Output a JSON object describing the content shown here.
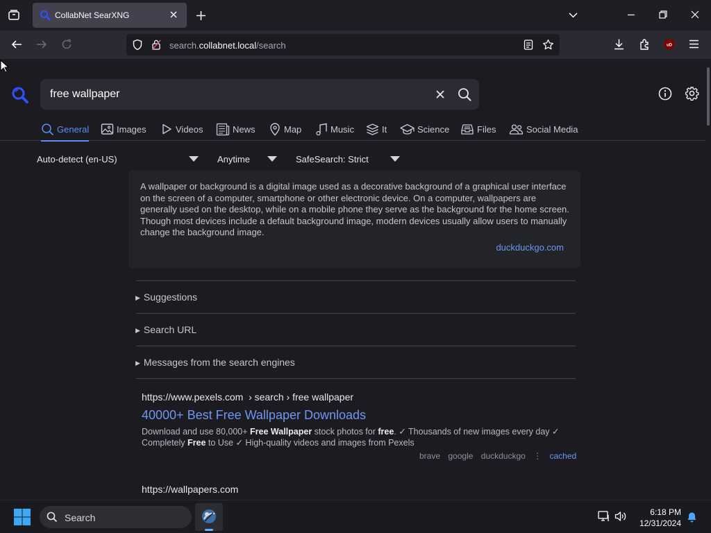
{
  "browser": {
    "tab_title": "CollabNet SearXNG",
    "url_host": "search.collabnet.local",
    "url_path": "/search",
    "url_prefix": "search.",
    "url_domain": "collabnet.local",
    "addon_badge": "uD"
  },
  "search": {
    "query": "free wallpaper"
  },
  "categories": [
    {
      "label": "General",
      "icon": "search-icon",
      "active": true
    },
    {
      "label": "Images",
      "icon": "image-icon"
    },
    {
      "label": "Videos",
      "icon": "play-icon"
    },
    {
      "label": "News",
      "icon": "newspaper-icon"
    },
    {
      "label": "Map",
      "icon": "map-pin-icon"
    },
    {
      "label": "Music",
      "icon": "music-icon"
    },
    {
      "label": "It",
      "icon": "layers-icon"
    },
    {
      "label": "Science",
      "icon": "school-icon"
    },
    {
      "label": "Files",
      "icon": "file-tray-icon"
    },
    {
      "label": "Social Media",
      "icon": "people-icon"
    }
  ],
  "filters": {
    "language": "Auto-detect (en-US)",
    "time": "Anytime",
    "safesearch": "SafeSearch: Strict"
  },
  "infobox": {
    "text": "A wallpaper or background is a digital image used as a decorative background of a graphical user interface on the screen of a computer, smartphone or other electronic device. On a computer, wallpapers are generally used on the desktop, while on a mobile phone they serve as the background for the home screen. Though most devices include a default background image, modern devices usually allow users to manually change the background image.",
    "source": "duckduckgo.com"
  },
  "sections": {
    "suggestions": "Suggestions",
    "search_url": "Search URL",
    "messages": "Messages from the search engines"
  },
  "results": [
    {
      "url": "https://www.pexels.com",
      "breadcrumb": "› search › free wallpaper",
      "title": "40000+ Best Free Wallpaper Downloads",
      "snippet_parts": [
        "Download and use 80,000+ ",
        "Free Wallpaper",
        " stock photos for ",
        "free",
        ". ✓ Thousands of new images every day ✓ Completely ",
        "Free",
        " to Use ✓ High-quality videos and images from Pexels"
      ],
      "engines": [
        "brave",
        "google",
        "duckduckgo"
      ],
      "separator": "⋮",
      "cached": "cached"
    },
    {
      "url": "https://wallpapers.com"
    }
  ],
  "taskbar": {
    "search_label": "Search",
    "time": "6:18 PM",
    "date": "12/31/2024"
  },
  "colors": {
    "accent": "#5e8ff3",
    "link": "#6e98ef",
    "page_bg": "#1c1b22"
  }
}
